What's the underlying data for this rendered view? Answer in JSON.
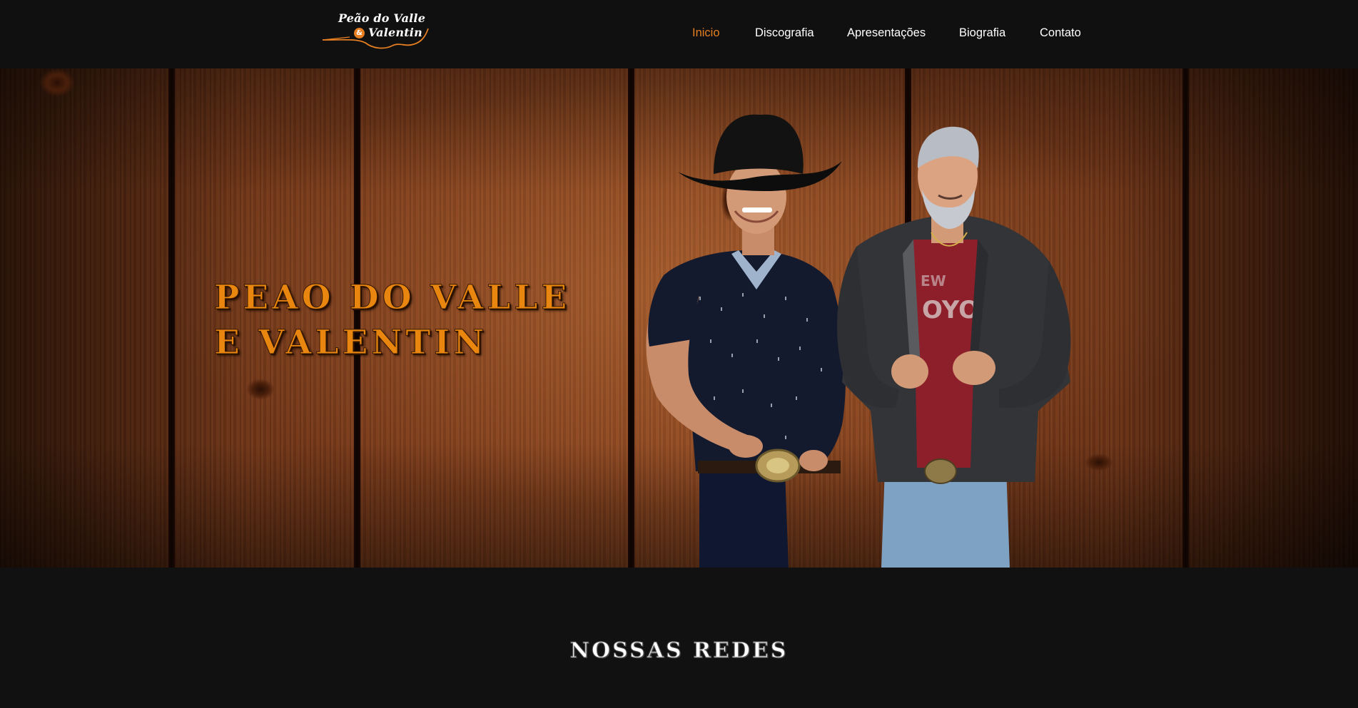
{
  "header": {
    "logo": {
      "line1": "Peão do Valle",
      "ampersand": "&",
      "line2": "Valentin"
    },
    "nav": [
      {
        "label": "Inicio",
        "active": true
      },
      {
        "label": "Discografia",
        "active": false
      },
      {
        "label": "Apresentações",
        "active": false
      },
      {
        "label": "Biografia",
        "active": false
      },
      {
        "label": "Contato",
        "active": false
      }
    ]
  },
  "hero": {
    "title_line1": "PEAO DO VALLE",
    "title_line2": "E VALENTIN"
  },
  "section": {
    "title": "NOSSAS REDES"
  },
  "colors": {
    "accent": "#e67e22",
    "header_bg": "#101010",
    "page_bg": "#111111",
    "wood": "#7a3a1a"
  }
}
